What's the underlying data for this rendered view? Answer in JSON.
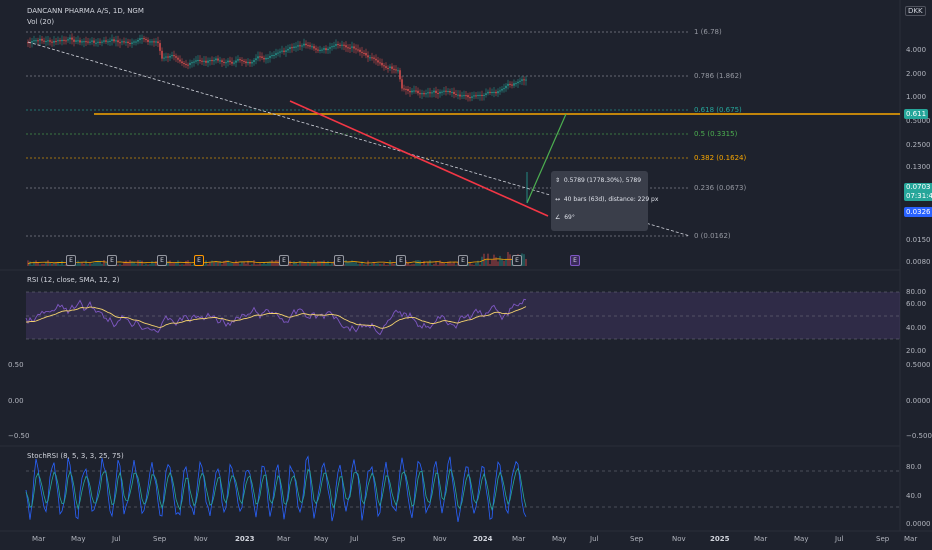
{
  "header": {
    "symbol": "DANCANN PHARMA A/S, 1D, NGM",
    "volume": "Vol (20)",
    "currency": "DKK"
  },
  "colors": {
    "bg": "#1e222d",
    "grid": "#2a2e39",
    "up": "#26a69a",
    "down": "#ef5350",
    "rsi": "#7e57c2",
    "rsi_ma": "#f5d36e",
    "stoch_k": "#2962ff",
    "stoch_d": "#26a69a",
    "fib_orange": "#f7a600",
    "trend_red": "#f23645",
    "forecast_green": "#4caf50"
  },
  "fib_levels": [
    {
      "label": "1 (6.78)",
      "color": "#9598a1"
    },
    {
      "label": "0.786 (1.862)",
      "color": "#9598a1"
    },
    {
      "label": "0.618 (0.675)",
      "color": "#26a69a"
    },
    {
      "label": "0.5 (0.3315)",
      "color": "#4caf50"
    },
    {
      "label": "0.382 (0.1624)",
      "color": "#f7a600"
    },
    {
      "label": "0.236 (0.0673)",
      "color": "#9598a1"
    },
    {
      "label": "0 (0.0162)",
      "color": "#9598a1"
    }
  ],
  "price_axis": [
    "4.000",
    "2.000",
    "1.000",
    "0.5000",
    "0.2500",
    "0.1300",
    "0.0650",
    "0.0330",
    "0.0150",
    "0.0080"
  ],
  "price_badges": {
    "level": "0.611",
    "last": "0.0703",
    "countdown": "07:31:42",
    "prev": "0.0326"
  },
  "earnings_label": "E",
  "rsi": {
    "title": "RSI (12, close, SMA, 12, 2)",
    "axis": [
      "80.00",
      "60.00",
      "40.00",
      "20.00"
    ]
  },
  "left_axis": [
    "0.50",
    "0.00",
    "−0.50"
  ],
  "right_mid_axis": [
    "0.5000",
    "0.0000",
    "−0.5000"
  ],
  "stoch": {
    "title": "StochRSI (8, 5, 3, 3, 25, 75)",
    "axis": [
      "80.0",
      "40.0",
      "0.0000"
    ]
  },
  "time_axis": [
    "Mar",
    "May",
    "Jul",
    "Sep",
    "Nov",
    "2023",
    "Mar",
    "May",
    "Jul",
    "Sep",
    "Nov",
    "2024",
    "Mar",
    "May",
    "Jul",
    "Sep",
    "Nov",
    "2025",
    "Mar",
    "May",
    "Jul",
    "Sep",
    "Mar"
  ],
  "tooltip": {
    "line1": "0.5789 (1778.30%), 5789",
    "line2": "40 bars (63d), distance: 229 px",
    "line3": "69°"
  }
}
